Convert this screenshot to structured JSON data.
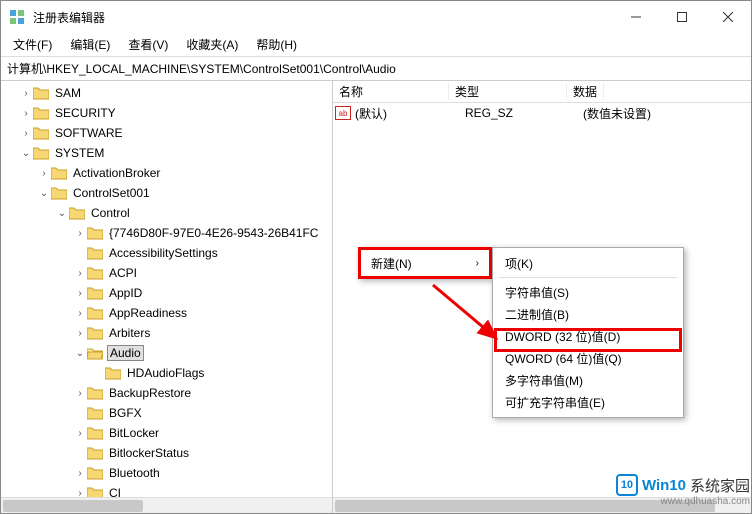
{
  "window": {
    "title": "注册表编辑器"
  },
  "menu": {
    "file": "文件(F)",
    "edit": "编辑(E)",
    "view": "查看(V)",
    "fav": "收藏夹(A)",
    "help": "帮助(H)"
  },
  "address": "计算机\\HKEY_LOCAL_MACHINE\\SYSTEM\\ControlSet001\\Control\\Audio",
  "tree": {
    "n0": "SAM",
    "n1": "SECURITY",
    "n2": "SOFTWARE",
    "n3": "SYSTEM",
    "n4": "ActivationBroker",
    "n5": "ControlSet001",
    "n6": "Control",
    "n7": "{7746D80F-97E0-4E26-9543-26B41FC",
    "n8": "AccessibilitySettings",
    "n9": "ACPI",
    "n10": "AppID",
    "n11": "AppReadiness",
    "n12": "Arbiters",
    "n13": "Audio",
    "n14": "HDAudioFlags",
    "n15": "BackupRestore",
    "n16": "BGFX",
    "n17": "BitLocker",
    "n18": "BitlockerStatus",
    "n19": "Bluetooth",
    "n20": "CI"
  },
  "cols": {
    "name": "名称",
    "type": "类型",
    "data": "数据"
  },
  "vals": {
    "def_name": "(默认)",
    "def_type": "REG_SZ",
    "def_data": "(数值未设置)"
  },
  "ctx1": {
    "new": "新建(N)"
  },
  "ctx2": {
    "key": "项(K)",
    "string": "字符串值(S)",
    "binary": "二进制值(B)",
    "dword": "DWORD (32 位)值(D)",
    "qword": "QWORD (64 位)值(Q)",
    "multi": "多字符串值(M)",
    "expand": "可扩充字符串值(E)"
  },
  "watermark": {
    "logo": "10",
    "t1": "Win10",
    "t2": "系统家园",
    "url": "www.qdhuasha.com"
  }
}
